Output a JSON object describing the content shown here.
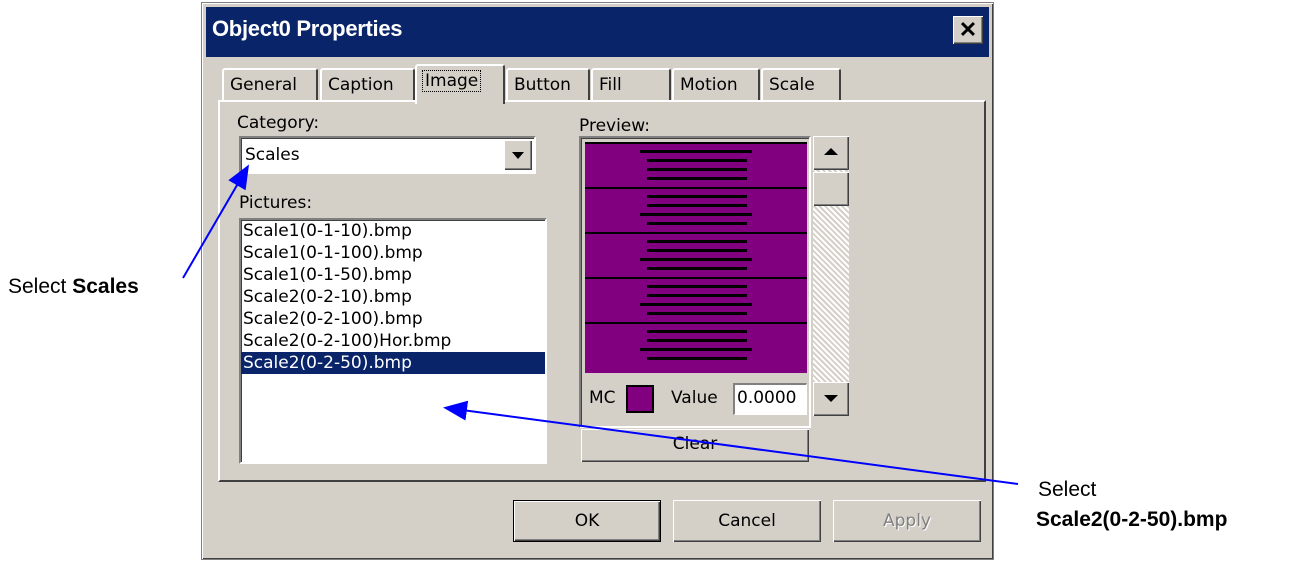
{
  "window": {
    "title": "Object0 Properties",
    "close_glyph": "✕"
  },
  "tabs": [
    {
      "label": "General",
      "active": false
    },
    {
      "label": "Caption",
      "active": false
    },
    {
      "label": "Image",
      "active": true
    },
    {
      "label": "Button",
      "active": false
    },
    {
      "label": "Fill",
      "active": false
    },
    {
      "label": "Motion",
      "active": false
    },
    {
      "label": "Scale",
      "active": false
    }
  ],
  "image_tab": {
    "category_label": "Category:",
    "category_value": "Scales",
    "pictures_label": "Pictures:",
    "pictures": [
      "Scale1(0-1-10).bmp",
      "Scale1(0-1-100).bmp",
      "Scale1(0-1-50).bmp",
      "Scale2(0-2-10).bmp",
      "Scale2(0-2-100).bmp",
      "Scale2(0-2-100)Hor.bmp",
      "Scale2(0-2-50).bmp"
    ],
    "selected_picture": "Scale2(0-2-50).bmp",
    "preview_label": "Preview:",
    "mc_label": "MC",
    "mc_color": "#800080",
    "value_label": "Value",
    "value": "0.0000",
    "clear_label": "Clear"
  },
  "buttons": {
    "ok": "OK",
    "cancel": "Cancel",
    "apply": "Apply"
  },
  "annotations": {
    "select_scales_prefix": "Select ",
    "select_scales_bold": "Scales",
    "select_pic_prefix": "Select",
    "select_pic_bold": "Scale2(0-2-50).bmp",
    "arrow_color": "#0000ff"
  },
  "colors": {
    "titlebar": "#0a246a",
    "face": "#d4d0c8",
    "selection": "#0a246a"
  }
}
